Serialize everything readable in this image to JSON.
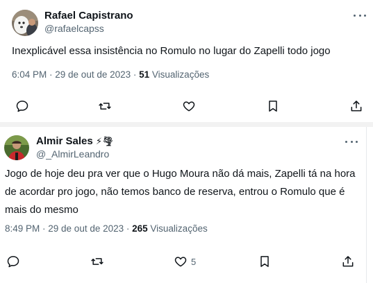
{
  "tweets": [
    {
      "author_name": "Rafael Capistrano",
      "handle": "@rafaelcapss",
      "text": "Inexplicável essa insistência no Romulo no lugar do Zapelli todo jogo",
      "time": "6:04 PM · 29 de out de 2023 · ",
      "views_count": "51",
      "views_label": " Visualizações",
      "likes_count": ""
    },
    {
      "author_name": "Almir Sales",
      "name_emojis": "⚡🌪",
      "handle": "@_AlmirLeandro",
      "text": "Jogo de hoje deu pra ver que o Hugo Moura não dá mais, Zapelli tá na hora de acordar pro jogo, não temos banco de reserva, entrou o Romulo que é mais do mesmo",
      "time": "8:49 PM · 29 de out de 2023 · ",
      "views_count": "265",
      "views_label": " Visualizações",
      "likes_count": "5"
    }
  ],
  "icons": [
    "reply-icon",
    "retweet-icon",
    "like-icon",
    "bookmark-icon",
    "share-icon",
    "more-icon"
  ],
  "colors": {
    "text": "#0f1419",
    "secondary": "#536471",
    "separator": "#f2f2f2"
  }
}
